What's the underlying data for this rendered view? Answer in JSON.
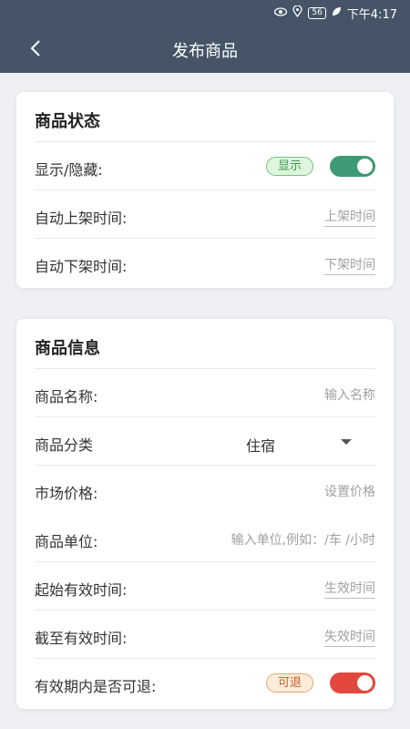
{
  "status_bar": {
    "battery": "56",
    "time": "下午4:17",
    "icons": [
      "eye-icon",
      "location-icon",
      "battery-icon",
      "leaf-icon"
    ]
  },
  "app_bar": {
    "title": "发布商品",
    "back_icon": "chevron-left-icon"
  },
  "status_card": {
    "title": "商品状态",
    "visibility": {
      "label": "显示/隐藏:",
      "badge": "显示",
      "on": true
    },
    "on_shelf": {
      "label": "自动上架时间:",
      "placeholder": "上架时间"
    },
    "off_shelf": {
      "label": "自动下架时间:",
      "placeholder": "下架时间"
    }
  },
  "info_card": {
    "title": "商品信息",
    "name": {
      "label": "商品名称:",
      "placeholder": "输入名称"
    },
    "category": {
      "label": "商品分类",
      "value": "住宿"
    },
    "price": {
      "label": "市场价格:",
      "placeholder": "设置价格"
    },
    "unit": {
      "label": "商品单位:",
      "placeholder": "输入单位,例如：/车 /小时"
    },
    "start_time": {
      "label": "起始有效时间:",
      "placeholder": "生效时间"
    },
    "end_time": {
      "label": "截至有效时间:",
      "placeholder": "失效时间"
    },
    "refundable": {
      "label": "有效期内是否可退:",
      "badge": "可退",
      "on": true
    }
  },
  "colors": {
    "header_bg": "#455567",
    "toggle_green": "#3e9a74",
    "toggle_red": "#e2483d"
  }
}
